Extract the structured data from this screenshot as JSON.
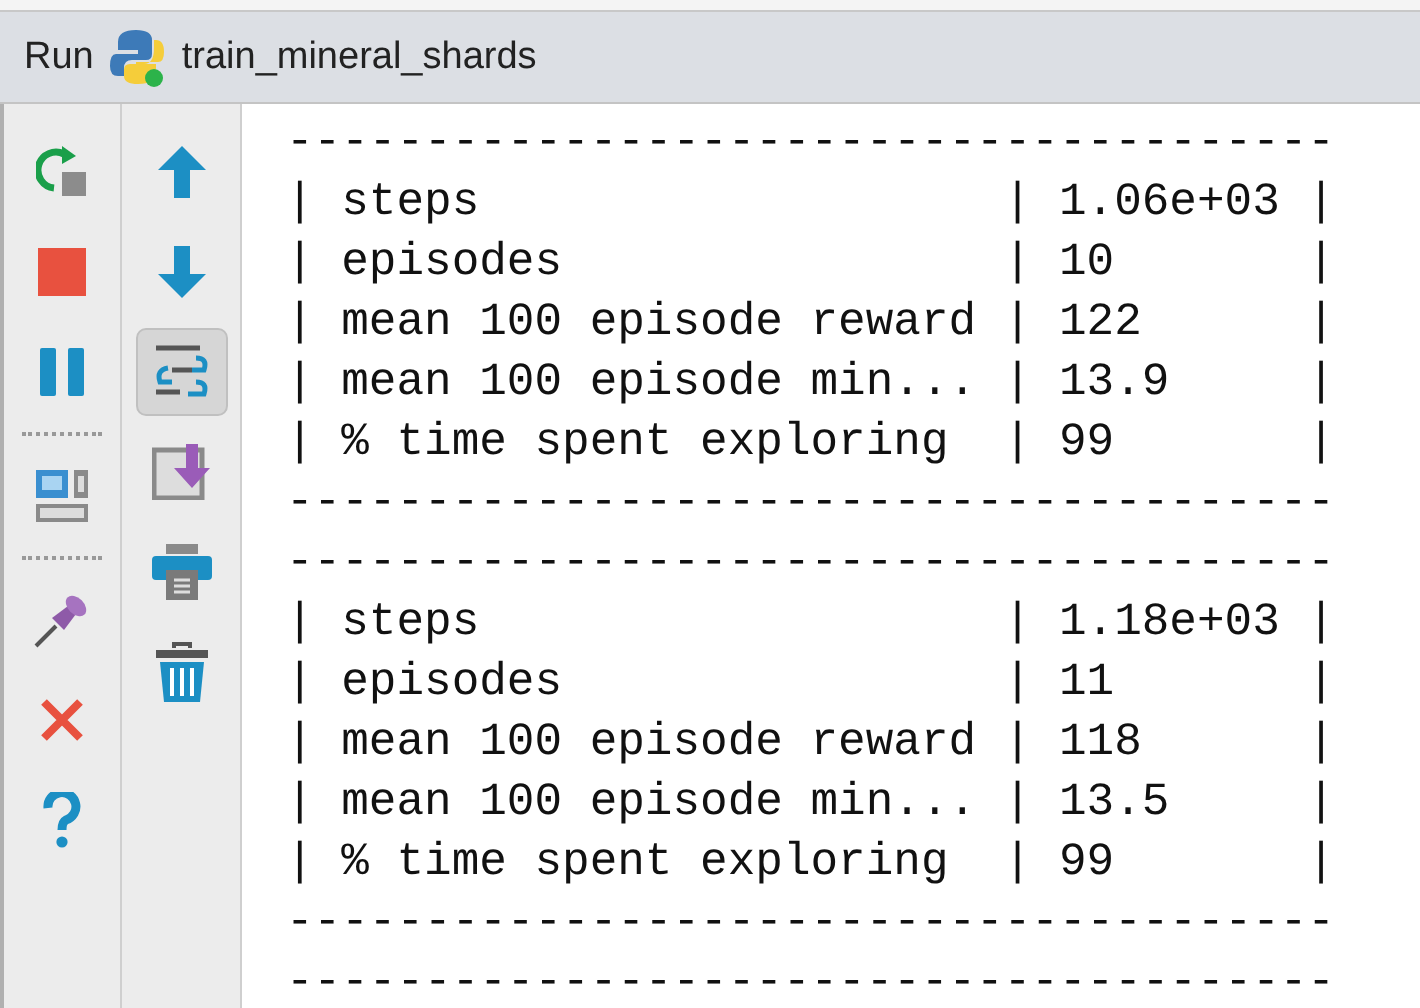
{
  "window": {
    "title": "Run",
    "config": "train_mineral_shards"
  },
  "toolbar_main": [
    {
      "kind": "rerun"
    },
    {
      "kind": "stop"
    },
    {
      "kind": "pause"
    },
    {
      "kind": "separator"
    },
    {
      "kind": "layout"
    },
    {
      "kind": "separator"
    },
    {
      "kind": "pin"
    },
    {
      "kind": "close"
    },
    {
      "kind": "help"
    }
  ],
  "toolbar_output": [
    {
      "kind": "up",
      "selected": false
    },
    {
      "kind": "down",
      "selected": false
    },
    {
      "kind": "soft-wrap",
      "selected": true
    },
    {
      "kind": "scroll-end",
      "selected": false
    },
    {
      "kind": "print",
      "selected": false
    },
    {
      "kind": "trash",
      "selected": false
    }
  ],
  "console": {
    "lines": [
      "--------------------------------------",
      "| steps                   | 1.06e+03 |",
      "| episodes                | 10       |",
      "| mean 100 episode reward | 122      |",
      "| mean 100 episode min... | 13.9     |",
      "| % time spent exploring  | 99       |",
      "--------------------------------------",
      "--------------------------------------",
      "| steps                   | 1.18e+03 |",
      "| episodes                | 11       |",
      "| mean 100 episode reward | 118      |",
      "| mean 100 episode min... | 13.5     |",
      "| % time spent exploring  | 99       |",
      "--------------------------------------",
      "--------------------------------------"
    ]
  }
}
